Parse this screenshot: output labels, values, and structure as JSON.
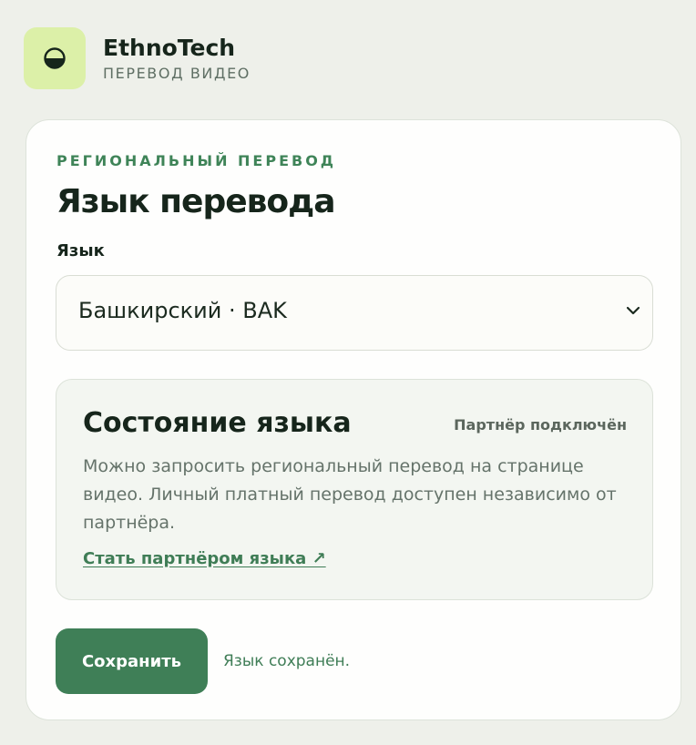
{
  "header": {
    "brand_name": "EthnoTech",
    "brand_subtitle": "ПЕРЕВОД ВИДЕО",
    "logo_icon": "half-circle-icon"
  },
  "card": {
    "eyebrow": "РЕГИОНАЛЬНЫЙ ПЕРЕВОД",
    "title": "Язык перевода",
    "language_field": {
      "label": "Язык",
      "selected_value": "Башкирский · BAK",
      "icon": "chevron-down-icon"
    },
    "language_status": {
      "title": "Состояние языка",
      "badge": "Партнёр подключён",
      "description": "Можно запросить региональный перевод на странице видео. Личный платный перевод доступен независимо от партнёра.",
      "link_label": "Стать партнёром языка ↗"
    },
    "save_button_label": "Сохранить",
    "save_status": "Язык сохранён."
  },
  "colors": {
    "background": "#eef0ea",
    "logo_bg": "#dcf0a8",
    "accent": "#3f7f57",
    "eyebrow": "#3f8458"
  }
}
